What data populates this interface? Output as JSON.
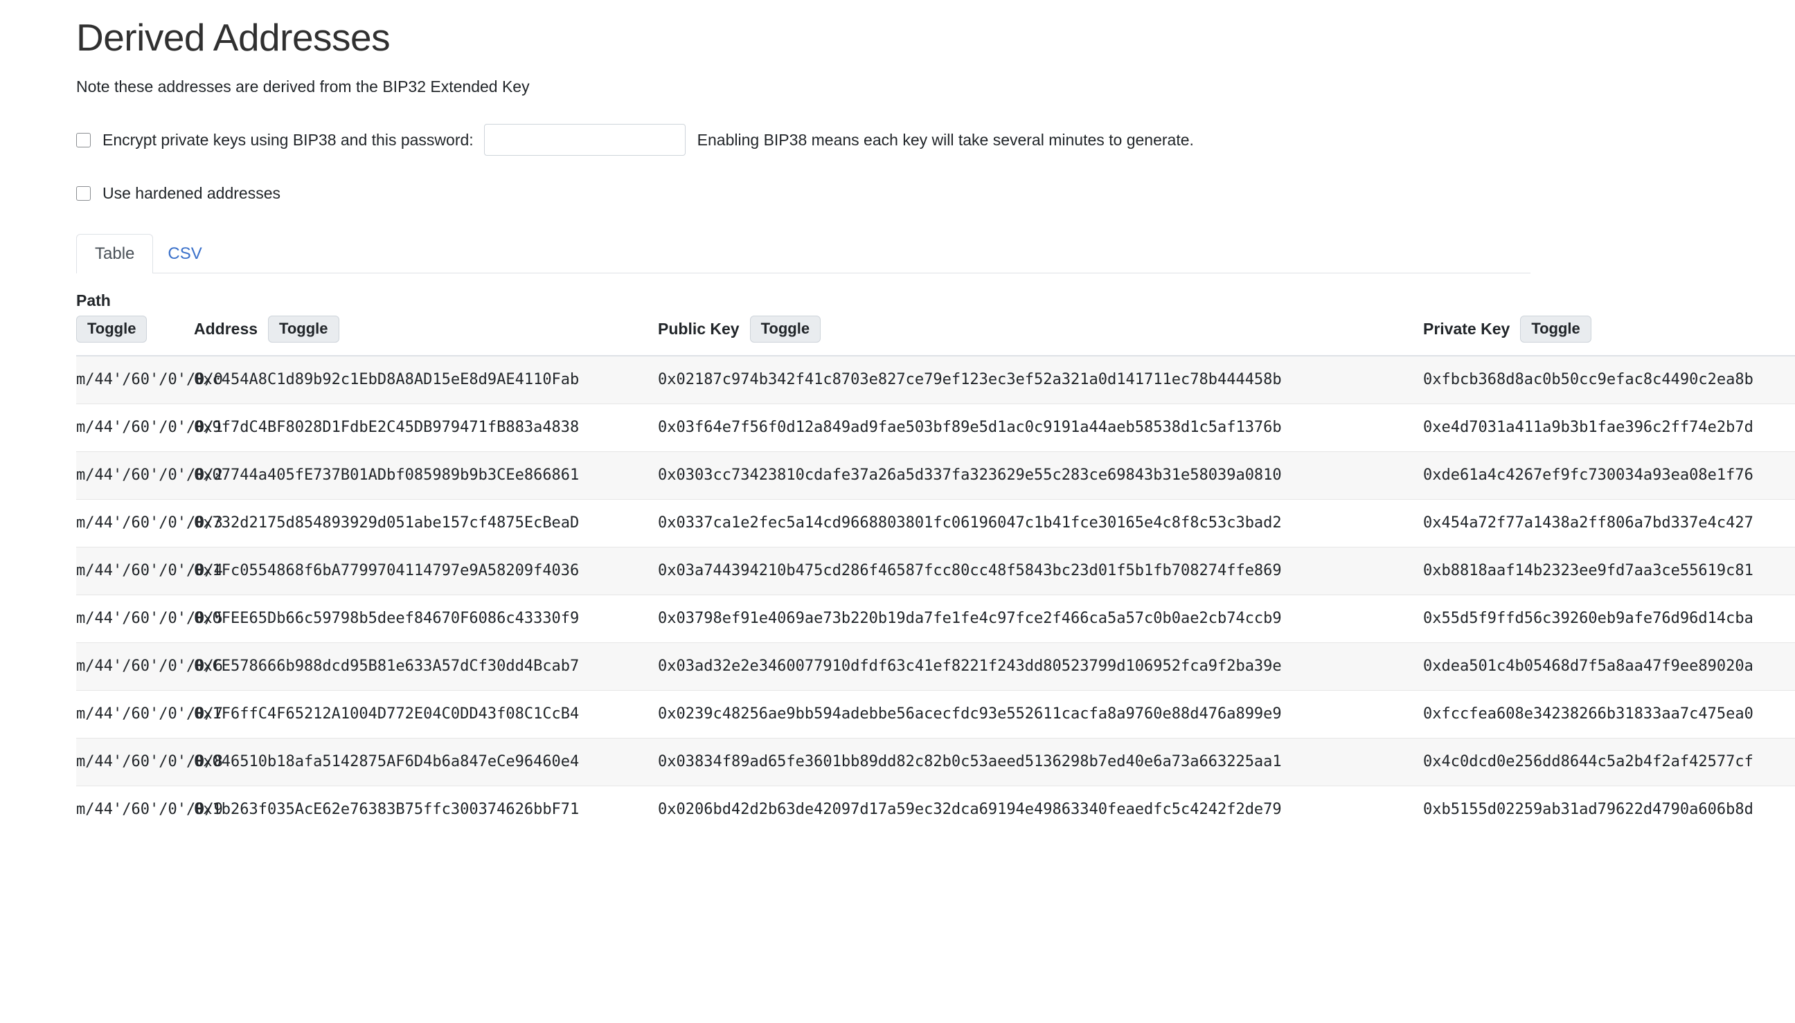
{
  "header": {
    "title": "Derived Addresses",
    "note": "Note these addresses are derived from the BIP32 Extended Key"
  },
  "options": {
    "bip38": {
      "label": "Encrypt private keys using BIP38 and this password:",
      "checked": false,
      "password_value": "",
      "password_placeholder": "",
      "hint": "Enabling BIP38 means each key will take several minutes to generate."
    },
    "hardened": {
      "label": "Use hardened addresses",
      "checked": false
    }
  },
  "tabs": [
    {
      "label": "Table",
      "active": true
    },
    {
      "label": "CSV",
      "active": false
    }
  ],
  "table": {
    "columns": [
      {
        "label": "Path",
        "toggle_label": "Toggle",
        "stacked": true
      },
      {
        "label": "Address",
        "toggle_label": "Toggle",
        "stacked": false
      },
      {
        "label": "Public Key",
        "toggle_label": "Toggle",
        "stacked": false
      },
      {
        "label": "Private Key",
        "toggle_label": "Toggle",
        "stacked": false
      }
    ],
    "rows": [
      {
        "path": "m/44'/60'/0'/0/0",
        "address": "0xc454A8C1d89b92c1EbD8A8AD15eE8d9AE4110Fab",
        "public_key": "0x02187c974b342f41c8703e827ce79ef123ec3ef52a321a0d141711ec78b444458b",
        "private_key": "0xfbcb368d8ac0b50cc9efac8c4490c2ea8b"
      },
      {
        "path": "m/44'/60'/0'/0/1",
        "address": "0x9f7dC4BF8028D1FdbE2C45DB979471fB883a4838",
        "public_key": "0x03f64e7f56f0d12a849ad9fae503bf89e5d1ac0c9191a44aeb58538d1c5af1376b",
        "private_key": "0xe4d7031a411a9b3b1fae396c2ff74e2b7d"
      },
      {
        "path": "m/44'/60'/0'/0/2",
        "address": "0x07744a405fE737B01ADbf085989b9b3CEe866861",
        "public_key": "0x0303cc73423810cdafe37a26a5d337fa323629e55c283ce69843b31e58039a0810",
        "private_key": "0xde61a4c4267ef9fc730034a93ea08e1f76"
      },
      {
        "path": "m/44'/60'/0'/0/3",
        "address": "0x732d2175d854893929d051abe157cf4875EcBeaD",
        "public_key": "0x0337ca1e2fec5a14cd9668803801fc06196047c1b41fce30165e4c8f8c53c3bad2",
        "private_key": "0x454a72f77a1438a2ff806a7bd337e4c427"
      },
      {
        "path": "m/44'/60'/0'/0/4",
        "address": "0x1Fc0554868f6bA7799704114797e9A58209f4036",
        "public_key": "0x03a744394210b475cd286f46587fcc80cc48f5843bc23d01f5b1fb708274ffe869",
        "private_key": "0xb8818aaf14b2323ee9fd7aa3ce55619c81"
      },
      {
        "path": "m/44'/60'/0'/0/5",
        "address": "0x0FEE65Db66c59798b5deef84670F6086c43330f9",
        "public_key": "0x03798ef91e4069ae73b220b19da7fe1fe4c97fce2f466ca5a57c0b0ae2cb74ccb9",
        "private_key": "0x55d5f9ffd56c39260eb9afe76d96d14cba"
      },
      {
        "path": "m/44'/60'/0'/0/6",
        "address": "0xCE578666b988dcd95B81e633A57dCf30dd4Bcab7",
        "public_key": "0x03ad32e2e3460077910dfdf63c41ef8221f243dd80523799d106952fca9f2ba39e",
        "private_key": "0xdea501c4b05468d7f5a8aa47f9ee89020a"
      },
      {
        "path": "m/44'/60'/0'/0/7",
        "address": "0x1F6ffC4F65212A1004D772E04C0DD43f08C1CcB4",
        "public_key": "0x0239c48256ae9bb594adebbe56acecfdc93e552611cacfa8a9760e88d476a899e9",
        "private_key": "0xfccfea608e34238266b31833aa7c475ea0"
      },
      {
        "path": "m/44'/60'/0'/0/8",
        "address": "0x046510b18afa5142875AF6D4b6a847eCe96460e4",
        "public_key": "0x03834f89ad65fe3601bb89dd82c82b0c53aeed5136298b7ed40e6a73a663225aa1",
        "private_key": "0x4c0dcd0e256dd8644c5a2b4f2af42577cf"
      },
      {
        "path": "m/44'/60'/0'/0/9",
        "address": "0x1b263f035AcE62e76383B75ffc300374626bbF71",
        "public_key": "0x0206bd42d2b63de42097d17a59ec32dca69194e49863340feaedfc5c4242f2de79",
        "private_key": "0xb5155d02259ab31ad79622d4790a606b8d"
      }
    ]
  },
  "colors": {
    "link": "#3b71ca",
    "text": "#212529",
    "row_alt": "#f7f7f7",
    "border": "#dee2e6"
  }
}
